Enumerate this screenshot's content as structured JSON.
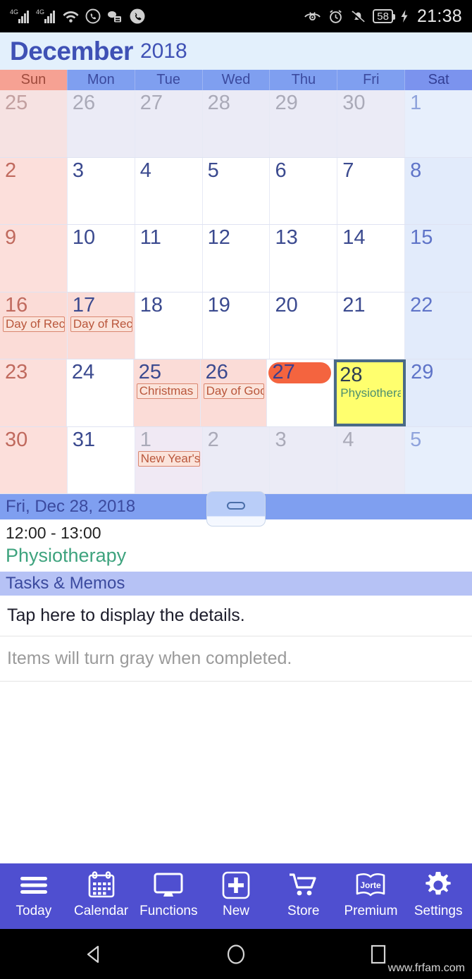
{
  "statusbar": {
    "icons_left": [
      "4g-signal-icon",
      "4g-signal-icon-2",
      "wifi-icon",
      "whatsapp-icon",
      "messages-icon",
      "phone-call-icon"
    ],
    "icons_right": [
      "eye-comfort-icon",
      "alarm-clock-icon",
      "mute-bell-icon"
    ],
    "battery_level": "58",
    "charging": "charging-bolt-icon",
    "time": "21:38"
  },
  "header": {
    "month": "December",
    "year": "2018"
  },
  "weekdays": [
    {
      "label": "Sun",
      "kind": "sun"
    },
    {
      "label": "Mon",
      "kind": "wk"
    },
    {
      "label": "Tue",
      "kind": "wk"
    },
    {
      "label": "Wed",
      "kind": "wk"
    },
    {
      "label": "Thu",
      "kind": "wk"
    },
    {
      "label": "Fri",
      "kind": "wk"
    },
    {
      "label": "Sat",
      "kind": "sat"
    }
  ],
  "calendar": {
    "rows": [
      [
        {
          "day": "25",
          "col": "sun",
          "other": true
        },
        {
          "day": "26",
          "col": "wk",
          "other": true
        },
        {
          "day": "27",
          "col": "wk",
          "other": true
        },
        {
          "day": "28",
          "col": "wk",
          "other": true
        },
        {
          "day": "29",
          "col": "wk",
          "other": true
        },
        {
          "day": "30",
          "col": "wk",
          "other": true
        },
        {
          "day": "1",
          "col": "sat",
          "other": true
        }
      ],
      [
        {
          "day": "2",
          "col": "sun"
        },
        {
          "day": "3",
          "col": "wk"
        },
        {
          "day": "4",
          "col": "wk"
        },
        {
          "day": "5",
          "col": "wk"
        },
        {
          "day": "6",
          "col": "wk"
        },
        {
          "day": "7",
          "col": "wk"
        },
        {
          "day": "8",
          "col": "sat"
        }
      ],
      [
        {
          "day": "9",
          "col": "sun"
        },
        {
          "day": "10",
          "col": "wk"
        },
        {
          "day": "11",
          "col": "wk"
        },
        {
          "day": "12",
          "col": "wk"
        },
        {
          "day": "13",
          "col": "wk"
        },
        {
          "day": "14",
          "col": "wk"
        },
        {
          "day": "15",
          "col": "sat"
        }
      ],
      [
        {
          "day": "16",
          "col": "sun",
          "holiday": true,
          "events": [
            {
              "text": "Day of Rec",
              "style": "holi"
            }
          ]
        },
        {
          "day": "17",
          "col": "wk",
          "holiday": true,
          "events": [
            {
              "text": "Day of Rec",
              "style": "holi"
            }
          ]
        },
        {
          "day": "18",
          "col": "wk"
        },
        {
          "day": "19",
          "col": "wk"
        },
        {
          "day": "20",
          "col": "wk"
        },
        {
          "day": "21",
          "col": "wk"
        },
        {
          "day": "22",
          "col": "sat"
        }
      ],
      [
        {
          "day": "23",
          "col": "sun"
        },
        {
          "day": "24",
          "col": "wk"
        },
        {
          "day": "25",
          "col": "wk",
          "holiday": true,
          "events": [
            {
              "text": "Christmas",
              "style": "holi"
            }
          ]
        },
        {
          "day": "26",
          "col": "wk",
          "holiday": true,
          "events": [
            {
              "text": "Day of Goo",
              "style": "holi"
            }
          ]
        },
        {
          "day": "27",
          "col": "wk",
          "today": true
        },
        {
          "day": "28",
          "col": "wk",
          "selected": true,
          "events": [
            {
              "text": "Physiothera",
              "style": "plain"
            }
          ]
        },
        {
          "day": "29",
          "col": "sat"
        }
      ],
      [
        {
          "day": "30",
          "col": "sun"
        },
        {
          "day": "31",
          "col": "wk"
        },
        {
          "day": "1",
          "col": "wk",
          "other": true,
          "holiday": true,
          "events": [
            {
              "text": "New Year's",
              "style": "holi"
            }
          ]
        },
        {
          "day": "2",
          "col": "wk",
          "other": true
        },
        {
          "day": "3",
          "col": "wk",
          "other": true
        },
        {
          "day": "4",
          "col": "wk",
          "other": true
        },
        {
          "day": "5",
          "col": "sat",
          "other": true
        }
      ]
    ]
  },
  "detail": {
    "date_label": "Fri, Dec 28, 2018",
    "handle": "drag-handle",
    "event_time": "12:00 - 13:00",
    "event_title": "Physiotherapy"
  },
  "tasks": {
    "header": "Tasks & Memos",
    "prompt": "Tap here to display the details.",
    "hint": "Items will turn gray when completed."
  },
  "bottomnav": [
    {
      "label": "Today",
      "icon": "hamburger-menu-icon"
    },
    {
      "label": "Calendar",
      "icon": "calendar-icon"
    },
    {
      "label": "Functions",
      "icon": "monitor-icon"
    },
    {
      "label": "New",
      "icon": "plus-box-icon"
    },
    {
      "label": "Store",
      "icon": "shopping-cart-icon"
    },
    {
      "label": "Premium",
      "icon": "jorte-book-icon"
    },
    {
      "label": "Settings",
      "icon": "gear-icon"
    }
  ],
  "androidnav": {
    "back": "back-triangle-icon",
    "home": "home-circle-icon",
    "recents": "recents-square-icon"
  },
  "watermark": "www.frfam.com",
  "colors": {
    "accent_blue": "#4f4fd0",
    "header_blue": "#7f9ff0",
    "sunday_pink": "#f6a193",
    "today_orange": "#f4643f",
    "selected_yellow": "#ffff6e",
    "event_green": "#3ea37e",
    "holiday_red": "#b9563b"
  }
}
